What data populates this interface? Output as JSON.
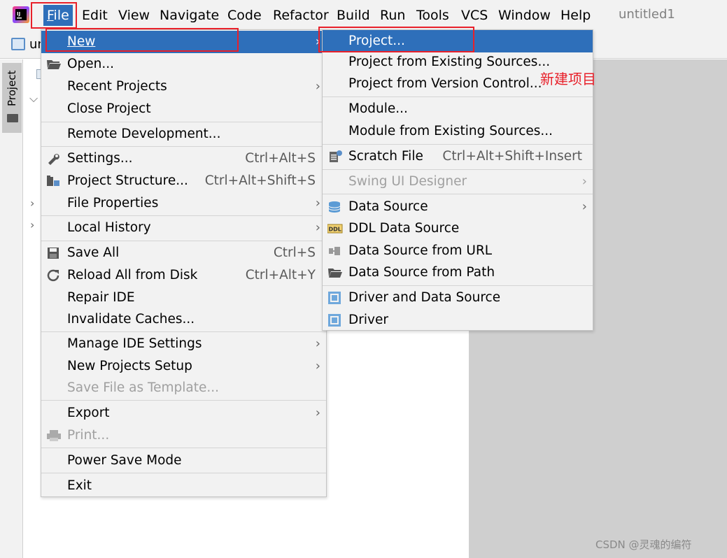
{
  "menubar": {
    "items": [
      {
        "label": "File",
        "mnemonic": "F",
        "rest": "ile"
      },
      {
        "label": "Edit"
      },
      {
        "label": "View"
      },
      {
        "label": "Navigate"
      },
      {
        "label": "Code"
      },
      {
        "label": "Refactor"
      },
      {
        "label": "Build"
      },
      {
        "label": "Run"
      },
      {
        "label": "Tools"
      },
      {
        "label": "VCS"
      },
      {
        "label": "Window"
      },
      {
        "label": "Help"
      }
    ],
    "window_title": "untitled1"
  },
  "toolbar": {
    "breadcrumb": "un"
  },
  "toolstrip": {
    "project_tab": "Project"
  },
  "file_menu": {
    "new": "New",
    "open": "Open...",
    "recent_projects": "Recent Projects",
    "close_project": "Close Project",
    "remote_development": "Remote Development...",
    "settings": "Settings...",
    "settings_shortcut": "Ctrl+Alt+S",
    "project_structure": "Project Structure...",
    "project_structure_shortcut": "Ctrl+Alt+Shift+S",
    "file_properties": "File Properties",
    "local_history": "Local History",
    "save_all": "Save All",
    "save_all_shortcut": "Ctrl+S",
    "reload_all": "Reload All from Disk",
    "reload_all_shortcut": "Ctrl+Alt+Y",
    "repair_ide": "Repair IDE",
    "invalidate_caches": "Invalidate Caches...",
    "manage_ide_settings": "Manage IDE Settings",
    "new_projects_setup": "New Projects Setup",
    "save_file_as_template": "Save File as Template...",
    "export": "Export",
    "print": "Print...",
    "power_save_mode": "Power Save Mode",
    "exit": "Exit"
  },
  "new_submenu": {
    "project": "Project...",
    "project_from_existing": "Project from Existing Sources...",
    "project_from_vcs": "Project from Version Control...",
    "module": "Module...",
    "module_from_existing": "Module from Existing Sources...",
    "scratch_file": "Scratch File",
    "scratch_file_shortcut": "Ctrl+Alt+Shift+Insert",
    "swing_ui_designer": "Swing UI Designer",
    "data_source": "Data Source",
    "ddl_data_source": "DDL Data Source",
    "data_source_from_url": "Data Source from URL",
    "data_source_from_path": "Data Source from Path",
    "driver_and_data_source": "Driver and Data Source",
    "driver": "Driver"
  },
  "annotation": "新建项目",
  "watermark": "CSDN @灵魂的编符",
  "colors": {
    "selection": "#2e6fba",
    "highlight_box": "#e8202a",
    "menu_bg": "#f2f2f2",
    "editor_bg": "#cfcfcf"
  }
}
